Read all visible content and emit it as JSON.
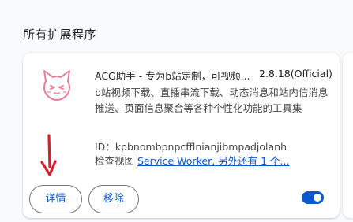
{
  "section": {
    "title": "所有扩展程序"
  },
  "extension": {
    "name": "ACG助手 - 专为b站定制，可视频...",
    "version": "2.8.18(Official)",
    "description": "b站视频下载、直播串流下载、动态消息和站内信消息推送、页面信息聚合等各种个性化功能的工具集",
    "id_label": "ID：",
    "id_value": "kpbnombpnpcfflnianjibmpadjolanh",
    "inspect_label": "检查视图",
    "inspect_link": "Service Worker, 另外还有 1 个...",
    "enabled": true,
    "icon": "cat-face-icon"
  },
  "buttons": {
    "details": "详情",
    "remove": "移除"
  },
  "colors": {
    "accent": "#0b57d0",
    "icon_pink": "#e87d9b",
    "arrow_red": "#d6202a"
  }
}
